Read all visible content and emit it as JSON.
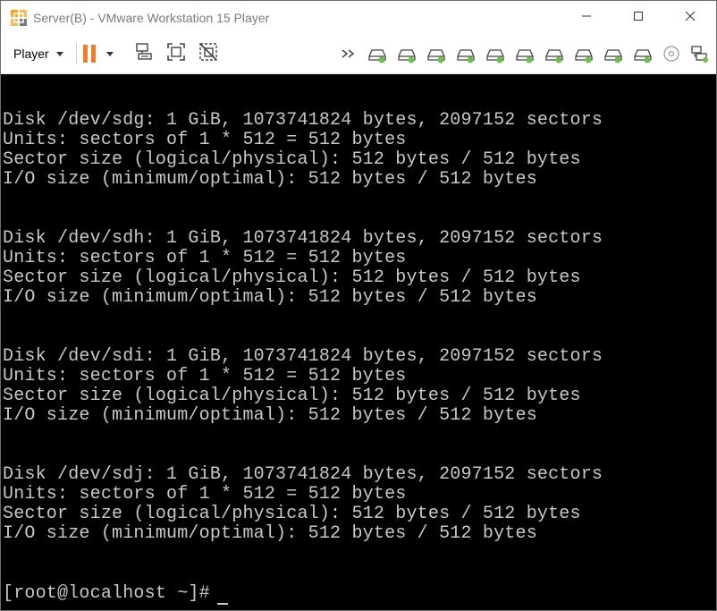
{
  "window": {
    "title": "Server(B) - VMware Workstation 15 Player"
  },
  "toolbar": {
    "player_label": "Player",
    "icons": [
      "pause-icon",
      "send-ctrl-alt-del-icon",
      "fit-guest-icon",
      "unity-icon"
    ],
    "devices": [
      "more-devices-icon",
      "hard-disk-icon",
      "hard-disk-icon",
      "hard-disk-icon",
      "hard-disk-icon",
      "hard-disk-icon",
      "hard-disk-icon",
      "hard-disk-icon",
      "hard-disk-icon",
      "hard-disk-icon",
      "hard-disk-icon",
      "cd-dvd-icon",
      "network-adapter-icon"
    ],
    "accent_color": "#f07a28",
    "device_active_color": "#6cc04a"
  },
  "console": {
    "lines": [
      "Disk /dev/sdg: 1 GiB, 1073741824 bytes, 2097152 sectors",
      "Units: sectors of 1 * 512 = 512 bytes",
      "Sector size (logical/physical): 512 bytes / 512 bytes",
      "I/O size (minimum/optimal): 512 bytes / 512 bytes",
      "Disk /dev/sdh: 1 GiB, 1073741824 bytes, 2097152 sectors",
      "Units: sectors of 1 * 512 = 512 bytes",
      "Sector size (logical/physical): 512 bytes / 512 bytes",
      "I/O size (minimum/optimal): 512 bytes / 512 bytes",
      "Disk /dev/sdi: 1 GiB, 1073741824 bytes, 2097152 sectors",
      "Units: sectors of 1 * 512 = 512 bytes",
      "Sector size (logical/physical): 512 bytes / 512 bytes",
      "I/O size (minimum/optimal): 512 bytes / 512 bytes",
      "Disk /dev/sdj: 1 GiB, 1073741824 bytes, 2097152 sectors",
      "Units: sectors of 1 * 512 = 512 bytes",
      "Sector size (logical/physical): 512 bytes / 512 bytes",
      "I/O size (minimum/optimal): 512 bytes / 512 bytes"
    ],
    "prompt": "[root@localhost ~]#"
  }
}
